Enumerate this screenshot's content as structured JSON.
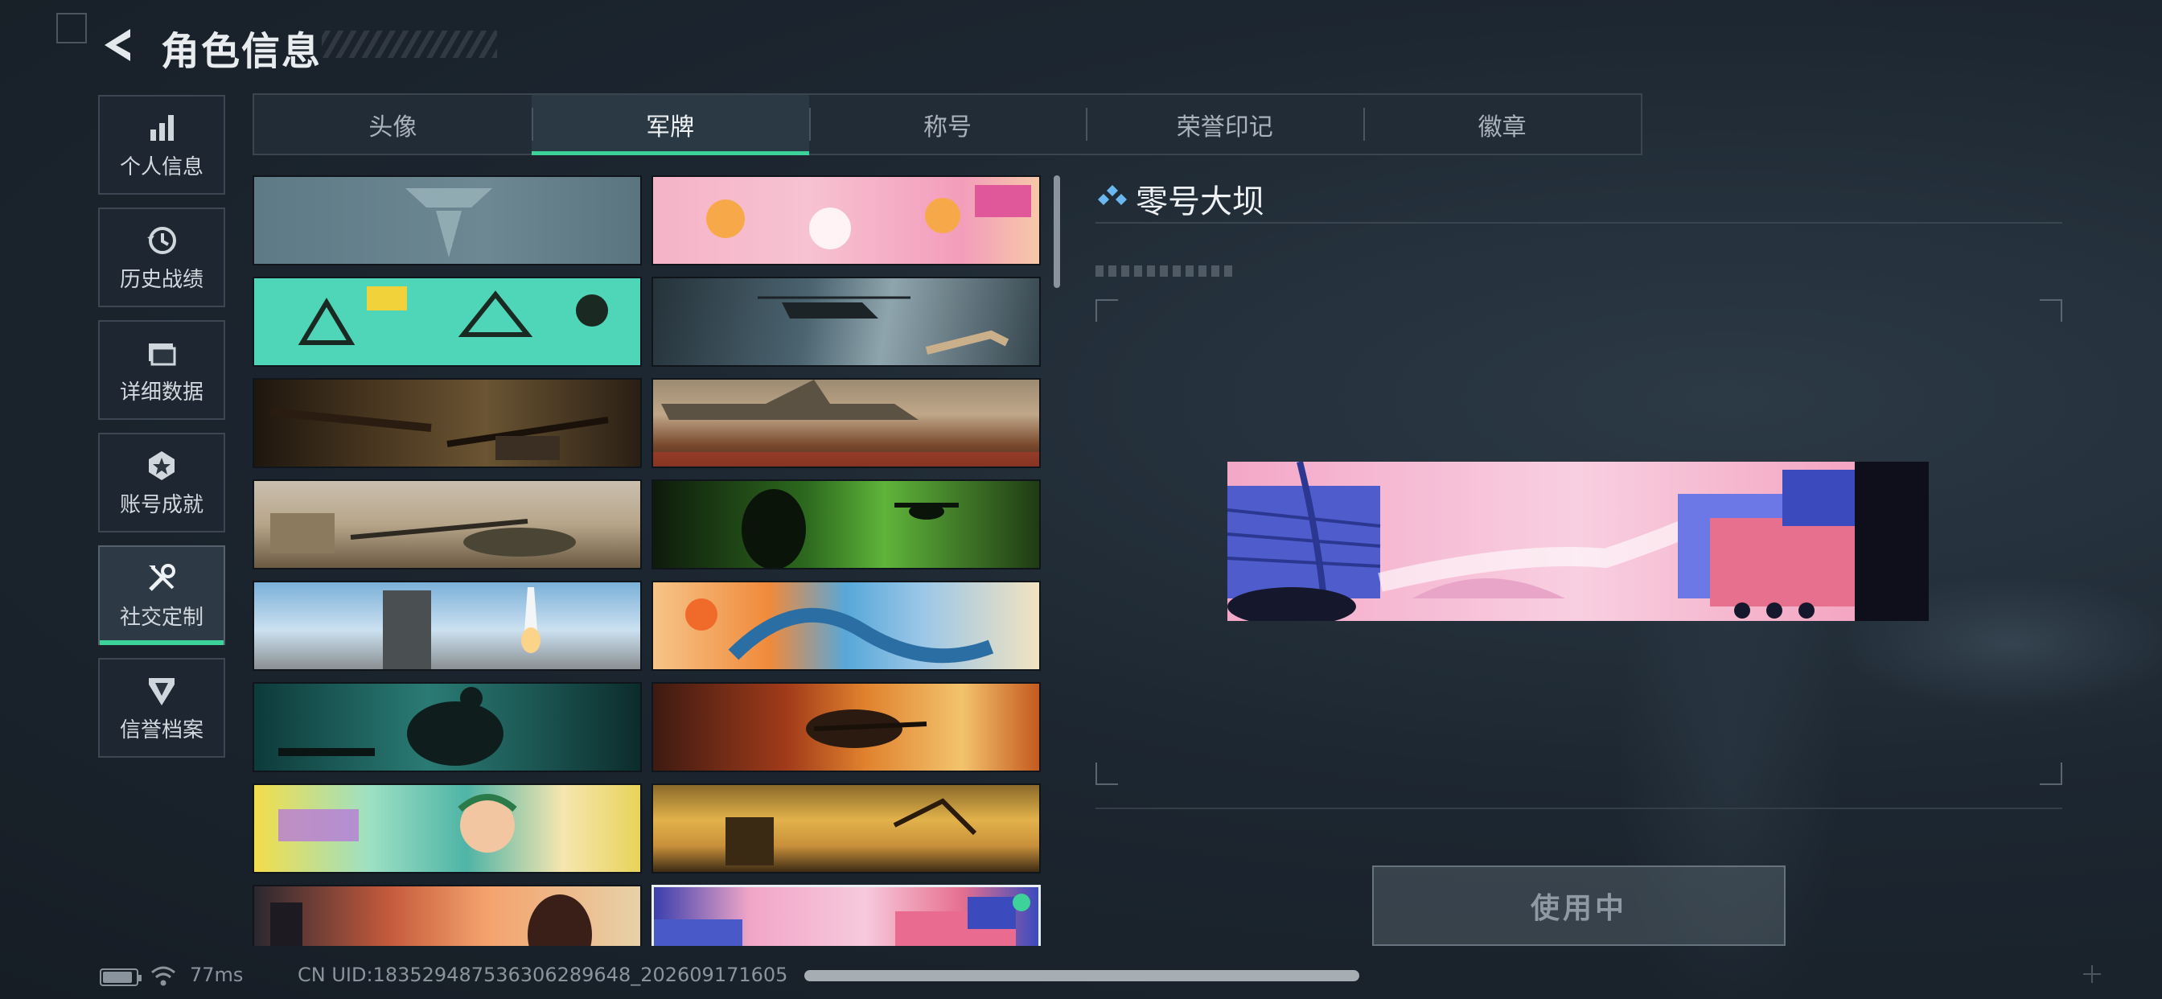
{
  "header": {
    "title": "角色信息",
    "back_icon": "back-arrow-icon"
  },
  "side_nav": {
    "items": [
      {
        "label": "个人信息",
        "icon": "bar-chart-icon",
        "active": false
      },
      {
        "label": "历史战绩",
        "icon": "history-clock-icon",
        "active": false
      },
      {
        "label": "详细数据",
        "icon": "folder-icon",
        "active": false
      },
      {
        "label": "账号成就",
        "icon": "medal-icon",
        "active": false
      },
      {
        "label": "社交定制",
        "icon": "tools-icon",
        "active": true
      },
      {
        "label": "信誉档案",
        "icon": "shield-badge-icon",
        "active": false
      }
    ]
  },
  "tabs": [
    {
      "label": "头像",
      "active": false
    },
    {
      "label": "军牌",
      "active": true
    },
    {
      "label": "称号",
      "active": false
    },
    {
      "label": "荣誉印记",
      "active": false
    },
    {
      "label": "徽章",
      "active": false
    }
  ],
  "cards": [
    {
      "art": "logo-emblem",
      "selected": false
    },
    {
      "art": "pink-cats",
      "selected": false
    },
    {
      "art": "green-cartoon",
      "selected": false
    },
    {
      "art": "helicopter-storm",
      "selected": false
    },
    {
      "art": "weapons-table",
      "selected": false
    },
    {
      "art": "bomber-plane",
      "selected": false
    },
    {
      "art": "sniper-desert",
      "selected": false
    },
    {
      "art": "night-vision",
      "selected": false
    },
    {
      "art": "rocket-launch",
      "selected": false
    },
    {
      "art": "ocean-wave",
      "selected": false
    },
    {
      "art": "gym-soldier",
      "selected": false
    },
    {
      "art": "desert-assault",
      "selected": false
    },
    {
      "art": "music-girl",
      "selected": false
    },
    {
      "art": "desert-sunset",
      "selected": false
    },
    {
      "art": "sunset-portrait",
      "selected": false
    },
    {
      "art": "zero-dam",
      "selected": true
    }
  ],
  "detail": {
    "title": "零号大坝",
    "button_label": "使用中",
    "diamond_icon": "diamond-cluster-icon"
  },
  "status": {
    "ping": "77ms",
    "uid": "CN UID:18352948753630628964​8_202609171605"
  },
  "colors": {
    "accent": "#3cd29a",
    "background": "#1d2731"
  }
}
